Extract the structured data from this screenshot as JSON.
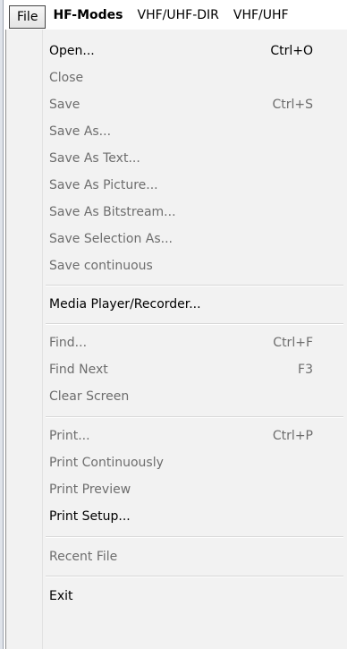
{
  "menubar": {
    "items": [
      {
        "label": "File"
      },
      {
        "label": "HF-Modes"
      },
      {
        "label": "VHF/UHF-DIR"
      },
      {
        "label": "VHF/UHF"
      }
    ]
  },
  "file_menu": {
    "groups": [
      {
        "items": [
          {
            "label": "Open...",
            "shortcut": "Ctrl+O",
            "enabled": true
          },
          {
            "label": "Close",
            "shortcut": "",
            "enabled": false
          },
          {
            "label": "Save",
            "shortcut": "Ctrl+S",
            "enabled": false
          },
          {
            "label": "Save As...",
            "shortcut": "",
            "enabled": false
          },
          {
            "label": "Save As Text...",
            "shortcut": "",
            "enabled": false
          },
          {
            "label": "Save As Picture...",
            "shortcut": "",
            "enabled": false
          },
          {
            "label": "Save As Bitstream...",
            "shortcut": "",
            "enabled": false
          },
          {
            "label": "Save Selection As...",
            "shortcut": "",
            "enabled": false
          },
          {
            "label": "Save continuous",
            "shortcut": "",
            "enabled": false
          }
        ]
      },
      {
        "items": [
          {
            "label": "Media Player/Recorder...",
            "shortcut": "",
            "enabled": true
          }
        ]
      },
      {
        "items": [
          {
            "label": "Find...",
            "shortcut": "Ctrl+F",
            "enabled": false
          },
          {
            "label": "Find Next",
            "shortcut": "F3",
            "enabled": false
          },
          {
            "label": "Clear Screen",
            "shortcut": "",
            "enabled": false
          }
        ]
      },
      {
        "items": [
          {
            "label": "Print...",
            "shortcut": "Ctrl+P",
            "enabled": false
          },
          {
            "label": "Print Continuously",
            "shortcut": "",
            "enabled": false
          },
          {
            "label": "Print Preview",
            "shortcut": "",
            "enabled": false
          },
          {
            "label": "Print Setup...",
            "shortcut": "",
            "enabled": true
          }
        ]
      },
      {
        "items": [
          {
            "label": "Recent File",
            "shortcut": "",
            "enabled": false
          }
        ]
      },
      {
        "items": [
          {
            "label": "Exit",
            "shortcut": "",
            "enabled": true
          }
        ]
      }
    ]
  }
}
